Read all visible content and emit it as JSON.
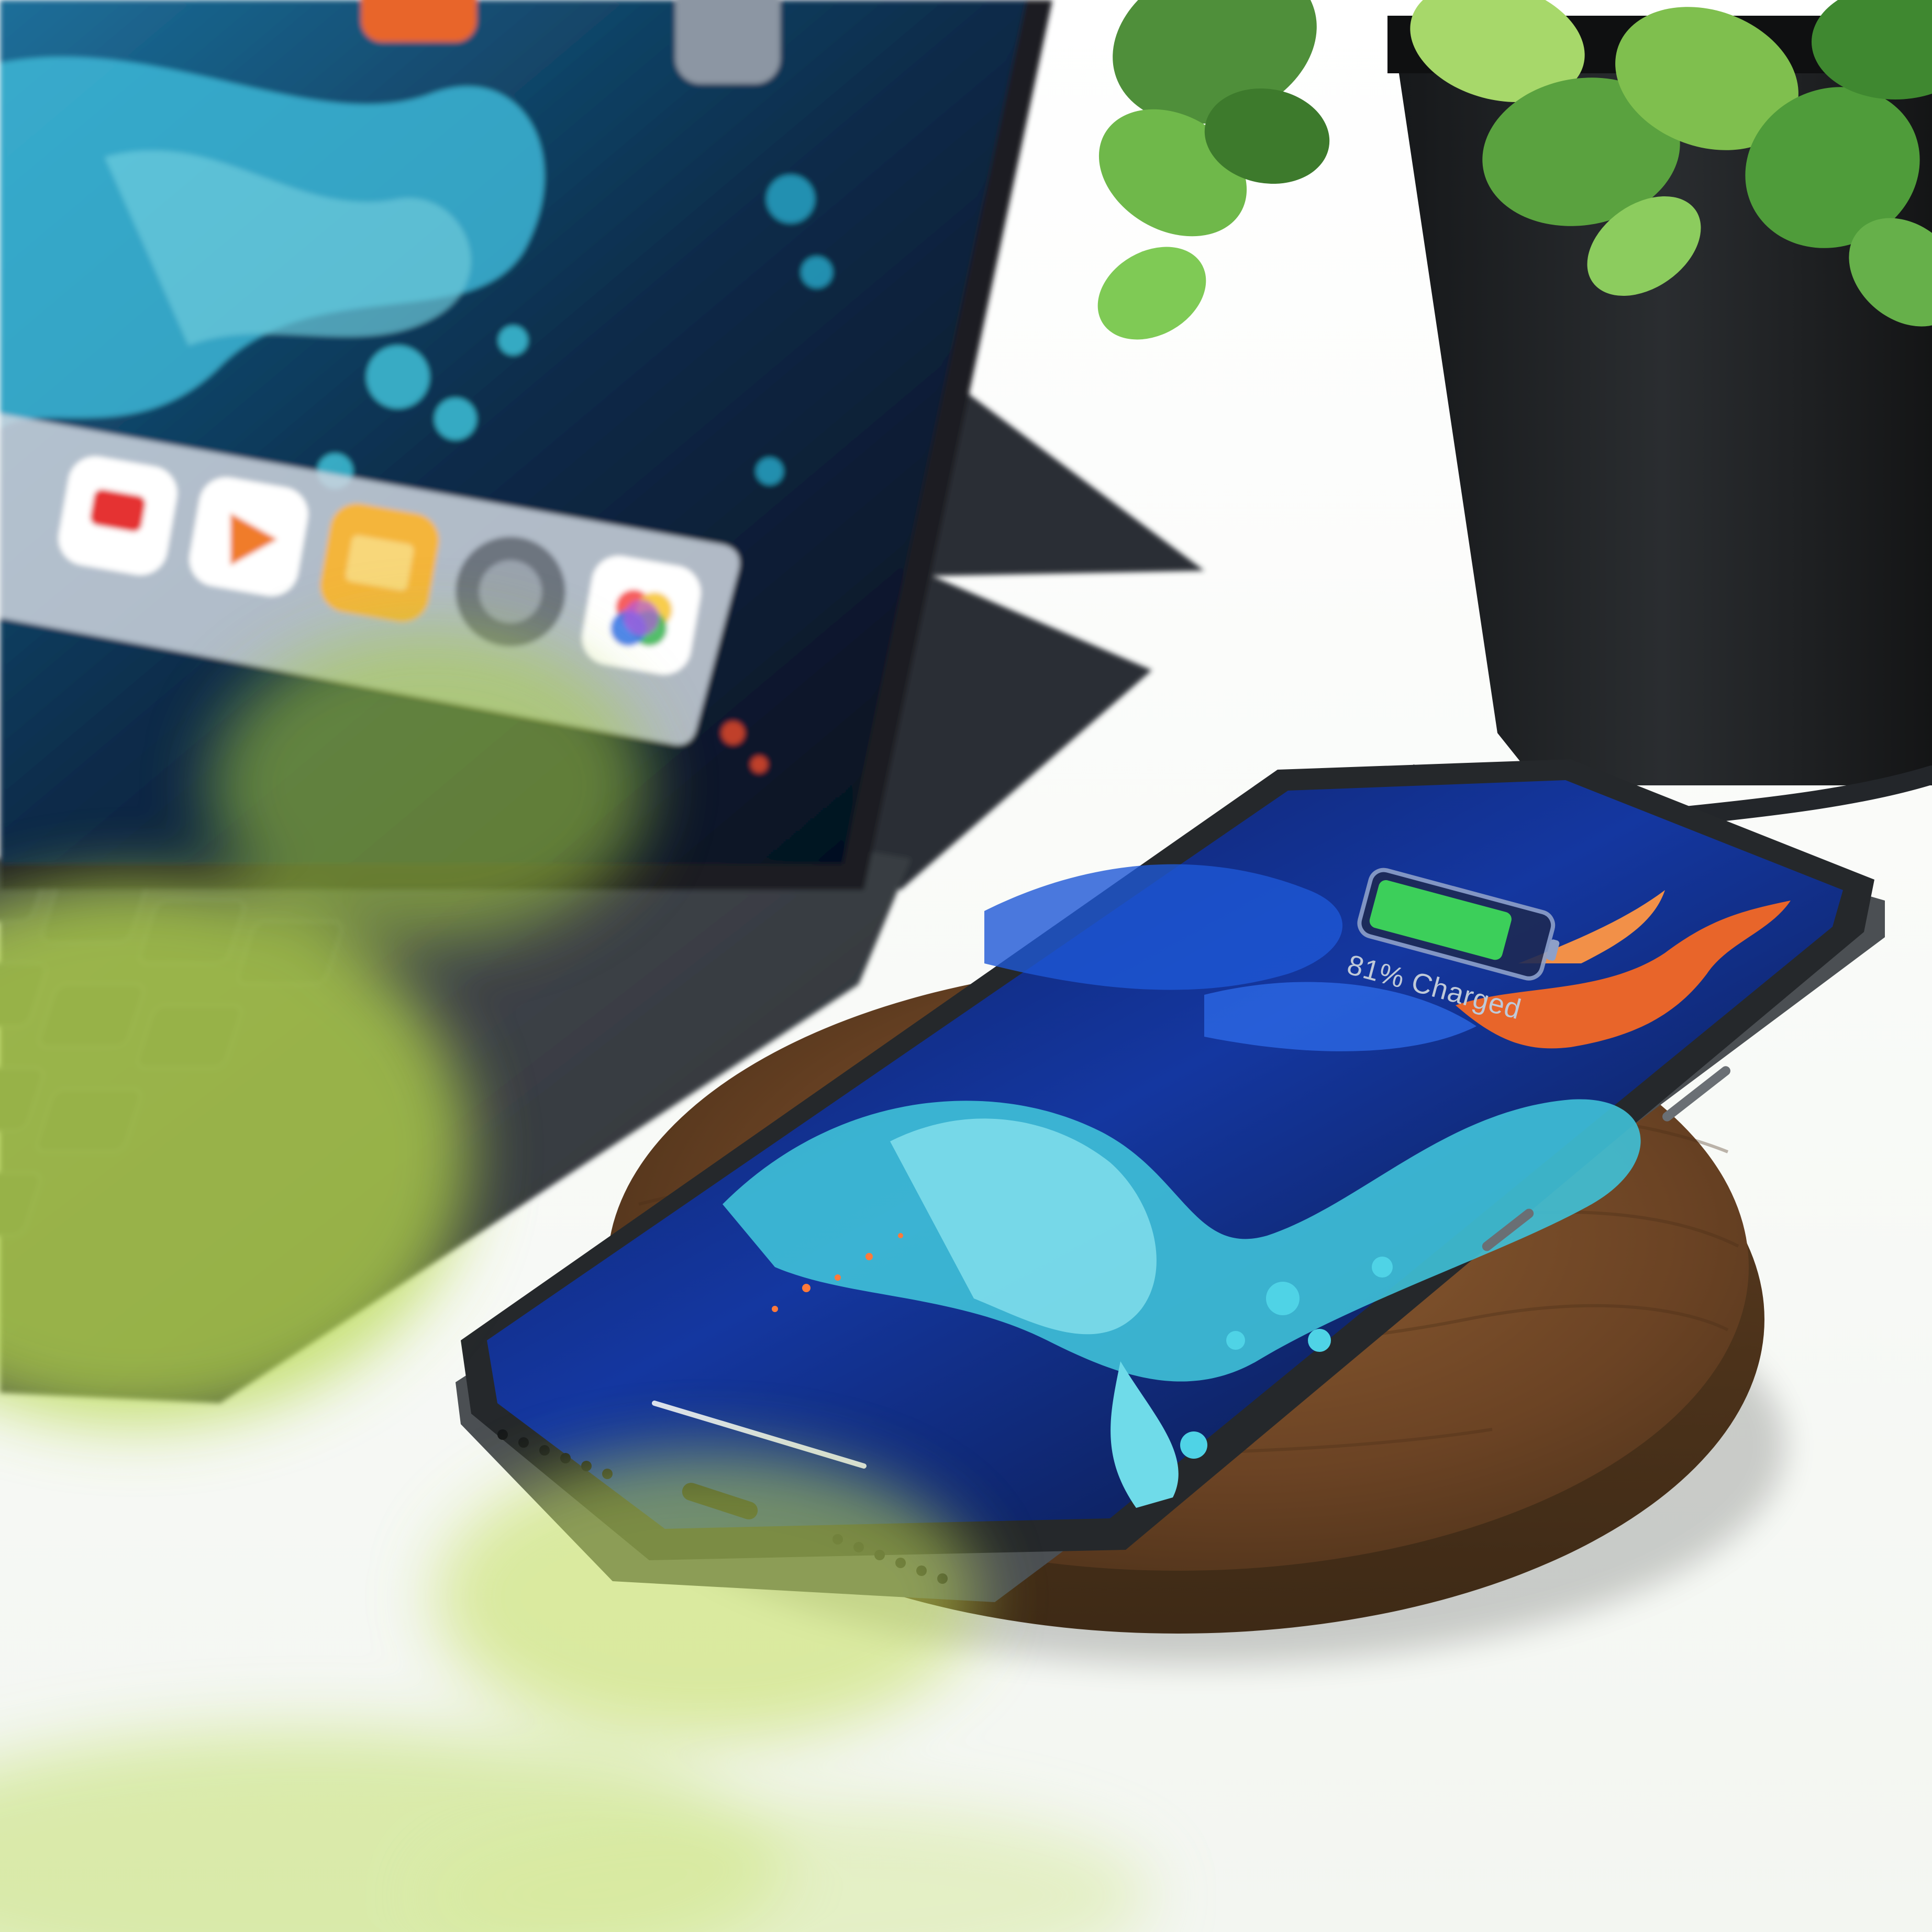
{
  "photo": {
    "phone_lock_screen": {
      "battery_status_text": "81% Charged",
      "battery_fill_fraction": 0.81
    }
  },
  "colors": {
    "desk": "#fbfcfa",
    "wood_pad": "#6e4a2a",
    "phone_frame": "#2a2d30",
    "wallpaper_blue": "#1a3fae",
    "wallpaper_cyan": "#3fc1d8",
    "wallpaper_orange": "#e8652a",
    "battery_green": "#3ccf5a",
    "tablet_case": "#3c4148",
    "plant_pot": "#1d1f21",
    "leaf_green": "#6fb84a",
    "foreground_blur_green": "#b7d84a"
  },
  "icons": [
    "youtube-app-icon",
    "infuse-app-icon",
    "files-app-icon",
    "settings-app-icon",
    "photos-app-icon"
  ]
}
